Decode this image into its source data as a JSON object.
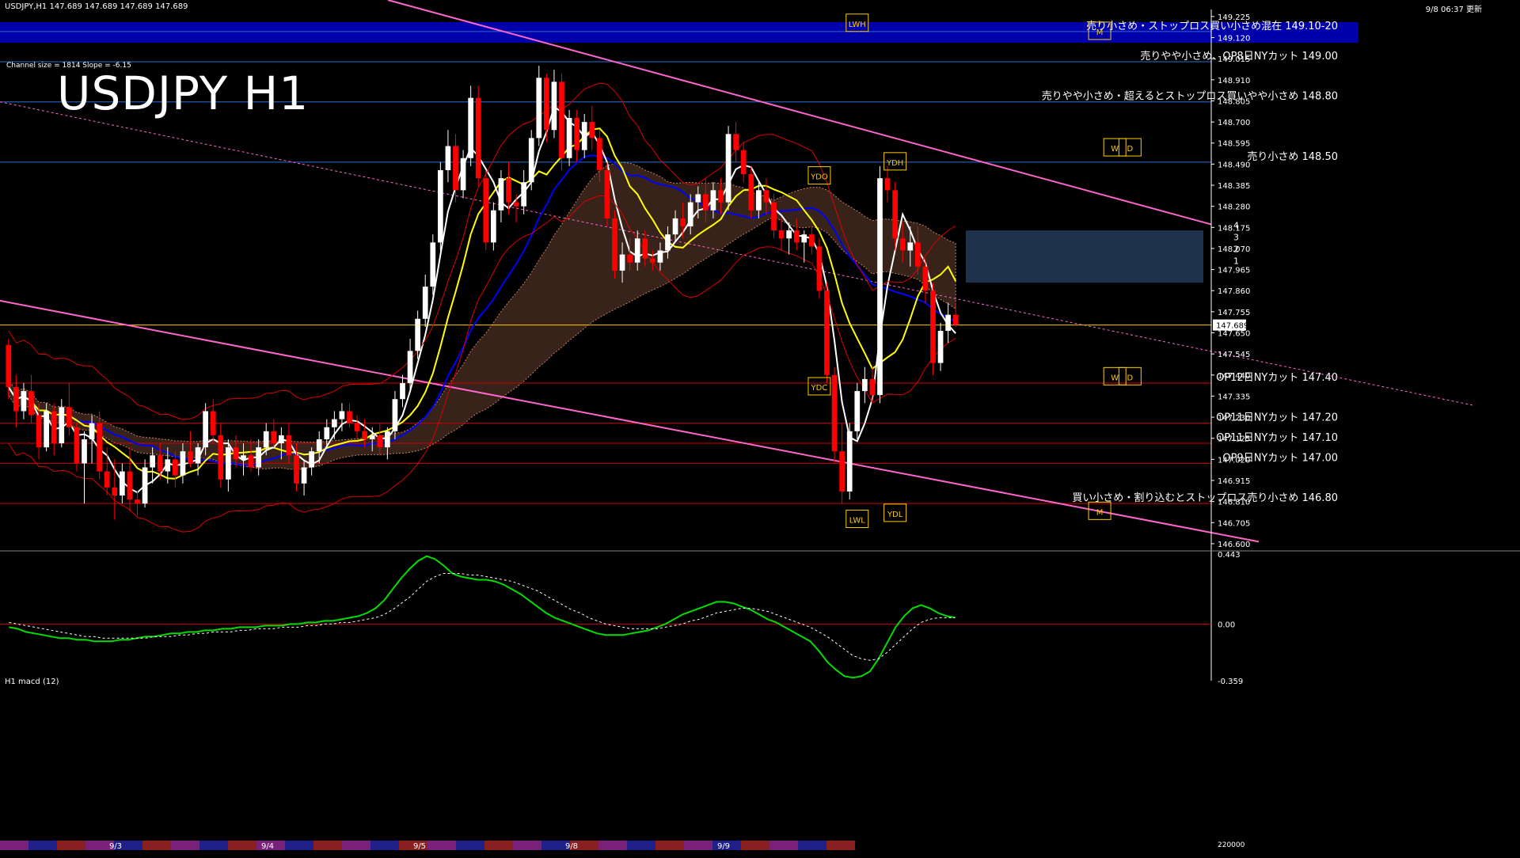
{
  "header": {
    "symbol_line": "USDJPY,H1  147.689 147.689 147.689 147.689",
    "timestamp": "9/8 06:37 更新"
  },
  "channel_info": "Channel size = 1814  Slope = -6.15",
  "title": "USDJPY H1",
  "macd_label": "H1  macd (12)",
  "colors": {
    "background": "#000000",
    "bull_candle": "#ffffff",
    "bear_candle": "#ff0000",
    "axis": "#ffffff",
    "ma_fast": "#ffffff",
    "ma_mid": "#ffff00",
    "ma_slow": "#0000ff",
    "channel": "#ff66cc",
    "bollinger": "#dd0000",
    "chikou": "#00cc00",
    "level_blue": "#2a6fd6",
    "level_red": "#cc0000",
    "level_yellow": "#ffcc00",
    "banner": "#0000aa",
    "cloud_bear": "#c87e5e",
    "cloud_bull": "#5a8fd8",
    "macd_main": "#00dd00",
    "macd_neg": "#ff9999",
    "macd_signal": "#ffffff"
  },
  "chart_data": {
    "type": "line",
    "symbol": "USDJPY",
    "timeframe": "H1",
    "last_price": 147.689,
    "price_ticks": [
      "149.225",
      "149.120",
      "149.015",
      "148.910",
      "148.805",
      "148.700",
      "148.595",
      "148.490",
      "148.385",
      "148.280",
      "148.175",
      "148.070",
      "147.965",
      "147.860",
      "147.755",
      "147.650",
      "147.545",
      "147.440",
      "147.335",
      "147.230",
      "147.125",
      "147.020",
      "146.915",
      "146.810",
      "146.705",
      "146.600"
    ],
    "price_range": [
      146.58,
      149.26
    ],
    "last_price_label": "147.689",
    "x_dates": [
      "9/3",
      "9/4",
      "9/5",
      "9/8",
      "9/9"
    ],
    "macd_ticks": [
      "0.443",
      "0.00",
      "-0.359"
    ],
    "macd_range": [
      -0.359,
      0.443
    ],
    "volume_tick": "220000",
    "levels": [
      {
        "price": 149.15,
        "label": "売り小さめ・ストップロス買い小さめ混在 149.10-20",
        "color": "#ffffff",
        "line": "#2a6fd6",
        "band": true
      },
      {
        "price": 149.0,
        "label": "売りやや小さめ、OP8日NYカット 149.00",
        "color": "#ffffff",
        "line": "#2a6fd6",
        "band": false
      },
      {
        "price": 148.8,
        "label": "売りやや小さめ・超えるとストップロス買いやや小さめ 148.80",
        "color": "#ffffff",
        "line": "#2a6fd6",
        "band": false
      },
      {
        "price": 148.5,
        "label": "売り小さめ 148.50",
        "color": "#ffffff",
        "line": "#2a6fd6",
        "band": false
      },
      {
        "price": 147.4,
        "label": "OP12日NYカット 147.40",
        "color": "#ffffff",
        "line": "#cc0000",
        "band": false
      },
      {
        "price": 147.2,
        "label": "OP11日NYカット 147.20",
        "color": "#ffffff",
        "line": "#cc0000",
        "band": false
      },
      {
        "price": 147.1,
        "label": "OP11日NYカット 147.10",
        "color": "#ffffff",
        "line": "#cc0000",
        "band": false
      },
      {
        "price": 147.0,
        "label": "OP9日NYカット 147.00",
        "color": "#ffffff",
        "line": "#cc0000",
        "band": false
      },
      {
        "price": 146.8,
        "label": "買い小さめ・割り込むとストップロス売り小さめ 146.80",
        "color": "#ffffff",
        "line": "#cc0000",
        "band": false
      }
    ],
    "markers": [
      {
        "label": "LWH",
        "bar": 112,
        "price": 149.19
      },
      {
        "label": "YDH",
        "bar": 117,
        "price": 148.5
      },
      {
        "label": "YDO",
        "bar": 107,
        "price": 148.43
      },
      {
        "label": "YDC",
        "bar": 107,
        "price": 147.38
      },
      {
        "label": "LWL",
        "bar": 112,
        "price": 146.72
      },
      {
        "label": "YDL",
        "bar": 117,
        "price": 146.75
      },
      {
        "label": "W",
        "bar": 146,
        "price": 148.57
      },
      {
        "label": "D",
        "bar": 148,
        "price": 148.57
      },
      {
        "label": "W",
        "bar": 146,
        "price": 147.43
      },
      {
        "label": "D",
        "bar": 148,
        "price": 147.43
      },
      {
        "label": "M",
        "bar": 144,
        "price": 149.15
      },
      {
        "label": "M",
        "bar": 144,
        "price": 146.76
      }
    ],
    "projection_labels": [
      "4",
      "3",
      "2",
      "1"
    ],
    "candles": [
      [
        147.59,
        147.62,
        147.32,
        147.38
      ],
      [
        147.38,
        147.44,
        147.18,
        147.26
      ],
      [
        147.26,
        147.4,
        147.22,
        147.36
      ],
      [
        147.36,
        147.44,
        147.2,
        147.24
      ],
      [
        147.24,
        147.3,
        147.02,
        147.08
      ],
      [
        147.08,
        147.3,
        147.06,
        147.26
      ],
      [
        147.26,
        147.3,
        147.04,
        147.1
      ],
      [
        147.1,
        147.32,
        147.08,
        147.28
      ],
      [
        147.28,
        147.4,
        147.14,
        147.18
      ],
      [
        147.18,
        147.2,
        146.96,
        147.0
      ],
      [
        147.0,
        147.16,
        146.8,
        147.12
      ],
      [
        147.12,
        147.24,
        147.0,
        147.2
      ],
      [
        147.2,
        147.26,
        146.92,
        146.96
      ],
      [
        146.96,
        147.08,
        146.84,
        146.88
      ],
      [
        146.88,
        147.02,
        146.72,
        146.84
      ],
      [
        146.84,
        147.0,
        146.8,
        146.96
      ],
      [
        146.96,
        147.08,
        146.76,
        146.82
      ],
      [
        146.82,
        146.86,
        146.74,
        146.8
      ],
      [
        146.8,
        147.02,
        146.78,
        146.98
      ],
      [
        146.98,
        147.08,
        146.9,
        147.04
      ],
      [
        147.04,
        147.1,
        146.92,
        146.96
      ],
      [
        146.96,
        147.08,
        146.9,
        147.02
      ],
      [
        147.02,
        147.06,
        146.88,
        146.94
      ],
      [
        146.94,
        147.1,
        146.9,
        147.06
      ],
      [
        147.06,
        147.16,
        146.98,
        147.0
      ],
      [
        147.0,
        147.1,
        146.94,
        147.08
      ],
      [
        147.08,
        147.3,
        147.04,
        147.26
      ],
      [
        147.26,
        147.32,
        147.1,
        147.14
      ],
      [
        147.14,
        147.2,
        146.88,
        146.92
      ],
      [
        146.92,
        147.12,
        146.86,
        147.08
      ],
      [
        147.08,
        147.14,
        146.98,
        147.02
      ],
      [
        147.02,
        147.1,
        146.94,
        147.04
      ],
      [
        147.04,
        147.12,
        146.96,
        146.98
      ],
      [
        146.98,
        147.12,
        146.94,
        147.08
      ],
      [
        147.08,
        147.2,
        147.04,
        147.16
      ],
      [
        147.16,
        147.22,
        147.08,
        147.1
      ],
      [
        147.1,
        147.18,
        147.02,
        147.14
      ],
      [
        147.14,
        147.2,
        147.0,
        147.04
      ],
      [
        147.04,
        147.1,
        146.86,
        146.9
      ],
      [
        146.9,
        147.02,
        146.84,
        146.98
      ],
      [
        146.98,
        147.08,
        146.94,
        147.06
      ],
      [
        147.06,
        147.16,
        147.0,
        147.12
      ],
      [
        147.12,
        147.22,
        147.08,
        147.18
      ],
      [
        147.18,
        147.26,
        147.12,
        147.22
      ],
      [
        147.22,
        147.3,
        147.16,
        147.26
      ],
      [
        147.26,
        147.3,
        147.18,
        147.2
      ],
      [
        147.2,
        147.24,
        147.12,
        147.16
      ],
      [
        147.16,
        147.22,
        147.08,
        147.12
      ],
      [
        147.12,
        147.18,
        147.06,
        147.14
      ],
      [
        147.14,
        147.2,
        147.04,
        147.08
      ],
      [
        147.08,
        147.18,
        147.02,
        147.16
      ],
      [
        147.16,
        147.36,
        147.12,
        147.32
      ],
      [
        147.32,
        147.44,
        147.28,
        147.4
      ],
      [
        147.4,
        147.62,
        147.36,
        147.56
      ],
      [
        147.56,
        147.76,
        147.52,
        147.72
      ],
      [
        147.72,
        147.94,
        147.68,
        147.88
      ],
      [
        147.88,
        148.14,
        147.84,
        148.1
      ],
      [
        148.1,
        148.5,
        148.06,
        148.46
      ],
      [
        148.46,
        148.66,
        148.4,
        148.58
      ],
      [
        148.58,
        148.64,
        148.3,
        148.36
      ],
      [
        148.36,
        148.56,
        148.32,
        148.52
      ],
      [
        148.52,
        148.88,
        148.48,
        148.82
      ],
      [
        148.82,
        148.88,
        148.38,
        148.42
      ],
      [
        148.42,
        148.46,
        148.06,
        148.1
      ],
      [
        148.1,
        148.3,
        148.06,
        148.26
      ],
      [
        148.26,
        148.46,
        148.2,
        148.42
      ],
      [
        148.42,
        148.5,
        148.24,
        148.3
      ],
      [
        148.3,
        148.34,
        148.2,
        148.28
      ],
      [
        148.28,
        148.46,
        148.24,
        148.4
      ],
      [
        148.4,
        148.66,
        148.36,
        148.62
      ],
      [
        148.62,
        148.98,
        148.58,
        148.92
      ],
      [
        148.92,
        148.94,
        148.6,
        148.66
      ],
      [
        148.66,
        148.96,
        148.62,
        148.9
      ],
      [
        148.9,
        148.94,
        148.46,
        148.52
      ],
      [
        148.52,
        148.76,
        148.48,
        148.72
      ],
      [
        148.72,
        148.76,
        148.5,
        148.56
      ],
      [
        148.56,
        148.74,
        148.52,
        148.7
      ],
      [
        148.7,
        148.78,
        148.56,
        148.62
      ],
      [
        148.62,
        148.66,
        148.4,
        148.46
      ],
      [
        148.46,
        148.5,
        148.18,
        148.22
      ],
      [
        148.22,
        148.26,
        147.92,
        147.96
      ],
      [
        147.96,
        148.1,
        147.9,
        148.04
      ],
      [
        148.04,
        148.12,
        147.96,
        148.0
      ],
      [
        148.0,
        148.16,
        147.96,
        148.12
      ],
      [
        148.12,
        148.16,
        147.98,
        148.02
      ],
      [
        148.02,
        148.06,
        147.96,
        148.0
      ],
      [
        148.0,
        148.1,
        147.96,
        148.06
      ],
      [
        148.06,
        148.18,
        148.02,
        148.14
      ],
      [
        148.14,
        148.26,
        148.1,
        148.22
      ],
      [
        148.22,
        148.3,
        148.12,
        148.18
      ],
      [
        148.18,
        148.34,
        148.14,
        148.3
      ],
      [
        148.3,
        148.38,
        148.22,
        148.34
      ],
      [
        148.34,
        148.42,
        148.2,
        148.26
      ],
      [
        148.26,
        148.4,
        148.22,
        148.36
      ],
      [
        148.36,
        148.42,
        148.24,
        148.3
      ],
      [
        148.3,
        148.68,
        148.26,
        148.64
      ],
      [
        148.64,
        148.7,
        148.5,
        148.56
      ],
      [
        148.56,
        148.6,
        148.4,
        148.44
      ],
      [
        148.44,
        148.48,
        148.22,
        148.26
      ],
      [
        148.26,
        148.4,
        148.22,
        148.36
      ],
      [
        148.36,
        148.42,
        148.24,
        148.3
      ],
      [
        148.3,
        148.34,
        148.12,
        148.16
      ],
      [
        148.16,
        148.22,
        148.06,
        148.12
      ],
      [
        148.12,
        148.2,
        148.04,
        148.16
      ],
      [
        148.16,
        148.22,
        148.06,
        148.1
      ],
      [
        148.1,
        148.16,
        148.0,
        148.14
      ],
      [
        148.14,
        148.18,
        148.04,
        148.08
      ],
      [
        148.08,
        148.12,
        147.82,
        147.86
      ],
      [
        147.86,
        147.9,
        147.4,
        147.44
      ],
      [
        147.44,
        147.48,
        147.0,
        147.06
      ],
      [
        147.06,
        147.2,
        146.8,
        146.86
      ],
      [
        146.86,
        147.2,
        146.82,
        147.16
      ],
      [
        147.16,
        147.4,
        147.12,
        147.36
      ],
      [
        147.36,
        147.48,
        147.3,
        147.42
      ],
      [
        147.42,
        147.48,
        147.3,
        147.34
      ],
      [
        147.34,
        148.48,
        147.3,
        148.42
      ],
      [
        148.42,
        148.48,
        148.3,
        148.36
      ],
      [
        148.36,
        148.4,
        148.06,
        148.12
      ],
      [
        148.12,
        148.2,
        148.0,
        148.06
      ],
      [
        148.06,
        148.18,
        147.98,
        148.1
      ],
      [
        148.1,
        148.18,
        147.94,
        147.98
      ],
      [
        147.98,
        148.02,
        147.8,
        147.86
      ],
      [
        147.86,
        147.9,
        147.44,
        147.5
      ],
      [
        147.5,
        147.7,
        147.46,
        147.66
      ],
      [
        147.66,
        147.8,
        147.6,
        147.74
      ],
      [
        147.74,
        147.8,
        147.68,
        147.689
      ]
    ],
    "macd": [
      -0.02,
      -0.03,
      -0.05,
      -0.06,
      -0.07,
      -0.08,
      -0.09,
      -0.09,
      -0.1,
      -0.1,
      -0.11,
      -0.11,
      -0.11,
      -0.1,
      -0.1,
      -0.09,
      -0.08,
      -0.08,
      -0.07,
      -0.06,
      -0.06,
      -0.05,
      -0.05,
      -0.04,
      -0.04,
      -0.03,
      -0.03,
      -0.02,
      -0.02,
      -0.02,
      -0.01,
      -0.01,
      -0.01,
      0.0,
      0.0,
      0.01,
      0.01,
      0.02,
      0.02,
      0.03,
      0.04,
      0.05,
      0.07,
      0.1,
      0.15,
      0.22,
      0.29,
      0.35,
      0.4,
      0.43,
      0.41,
      0.37,
      0.32,
      0.3,
      0.29,
      0.28,
      0.28,
      0.27,
      0.25,
      0.22,
      0.19,
      0.15,
      0.11,
      0.07,
      0.04,
      0.02,
      0.0,
      -0.02,
      -0.04,
      -0.06,
      -0.07,
      -0.07,
      -0.07,
      -0.06,
      -0.05,
      -0.04,
      -0.02,
      0.0,
      0.03,
      0.06,
      0.08,
      0.1,
      0.12,
      0.14,
      0.14,
      0.13,
      0.11,
      0.09,
      0.06,
      0.03,
      0.01,
      -0.02,
      -0.05,
      -0.08,
      -0.11,
      -0.17,
      -0.24,
      -0.29,
      -0.33,
      -0.34,
      -0.33,
      -0.3,
      -0.22,
      -0.12,
      -0.02,
      0.05,
      0.1,
      0.12,
      0.1,
      0.07,
      0.05,
      0.04
    ],
    "macd_signal_vals": [
      0.01,
      0.0,
      -0.01,
      -0.02,
      -0.03,
      -0.04,
      -0.05,
      -0.06,
      -0.07,
      -0.08,
      -0.08,
      -0.09,
      -0.09,
      -0.09,
      -0.09,
      -0.09,
      -0.09,
      -0.08,
      -0.08,
      -0.08,
      -0.07,
      -0.07,
      -0.06,
      -0.06,
      -0.05,
      -0.05,
      -0.05,
      -0.04,
      -0.04,
      -0.03,
      -0.03,
      -0.03,
      -0.02,
      -0.02,
      -0.02,
      -0.01,
      -0.01,
      0.0,
      0.0,
      0.01,
      0.01,
      0.02,
      0.03,
      0.04,
      0.06,
      0.09,
      0.13,
      0.17,
      0.22,
      0.27,
      0.3,
      0.32,
      0.32,
      0.32,
      0.31,
      0.31,
      0.3,
      0.29,
      0.28,
      0.27,
      0.25,
      0.23,
      0.21,
      0.18,
      0.15,
      0.12,
      0.09,
      0.07,
      0.04,
      0.02,
      0.0,
      -0.01,
      -0.02,
      -0.03,
      -0.03,
      -0.03,
      -0.03,
      -0.02,
      -0.01,
      0.0,
      0.02,
      0.03,
      0.05,
      0.07,
      0.08,
      0.09,
      0.1,
      0.1,
      0.09,
      0.08,
      0.06,
      0.04,
      0.02,
      0.0,
      -0.02,
      -0.05,
      -0.08,
      -0.12,
      -0.16,
      -0.2,
      -0.22,
      -0.23,
      -0.22,
      -0.18,
      -0.13,
      -0.08,
      -0.03,
      0.01,
      0.03,
      0.04,
      0.04,
      0.04
    ]
  }
}
